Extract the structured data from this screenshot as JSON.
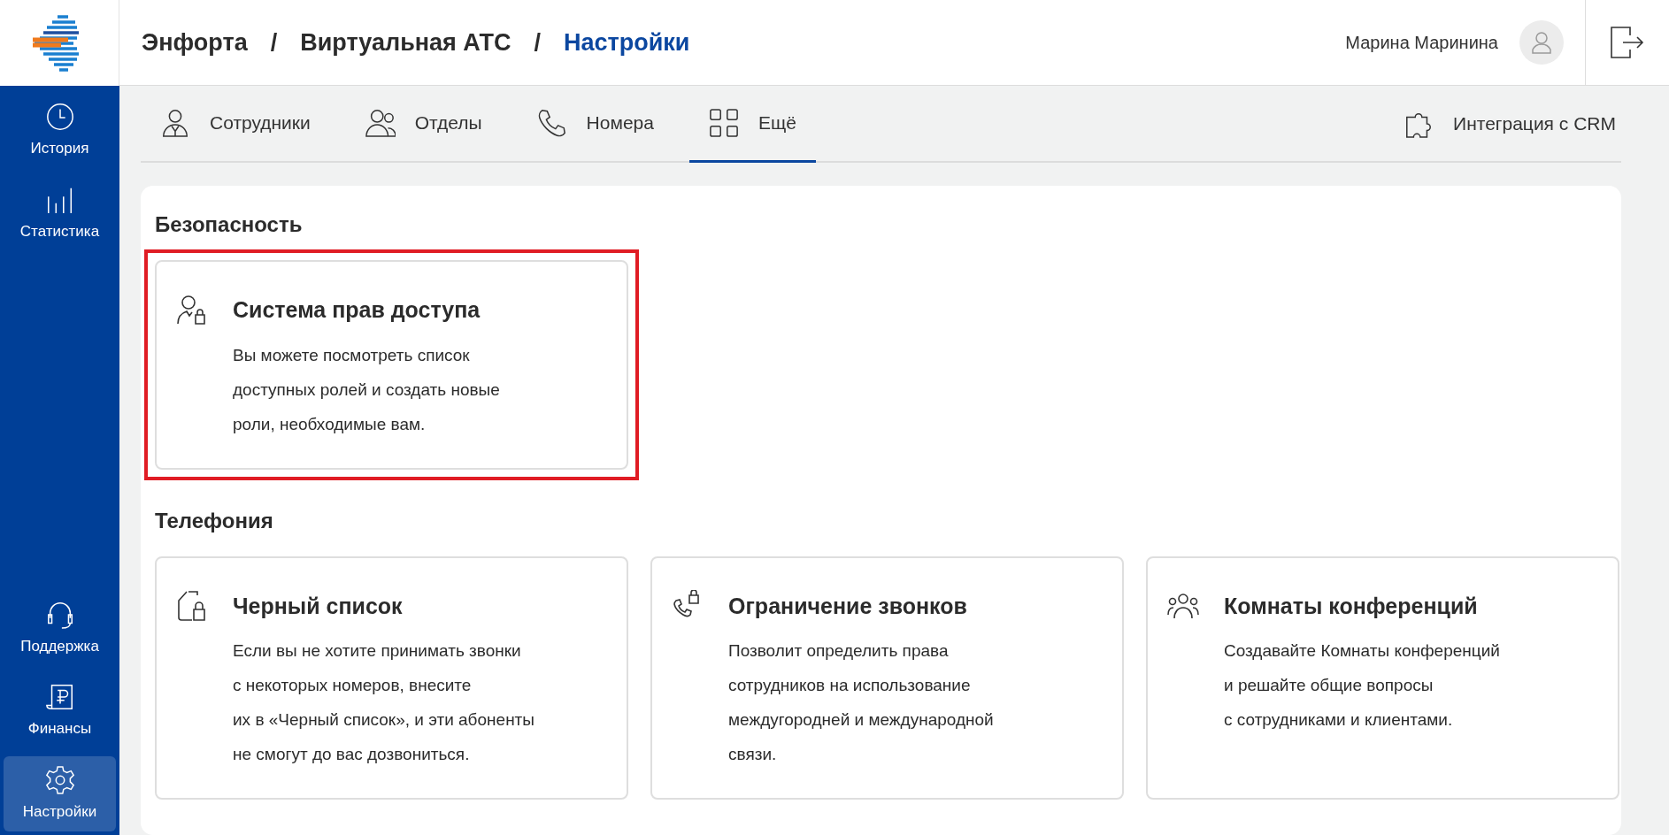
{
  "sidebar": {
    "items": [
      {
        "label": "История",
        "selected": false
      },
      {
        "label": "Статистика",
        "selected": false
      },
      {
        "label": "Поддержка",
        "selected": false
      },
      {
        "label": "Финансы",
        "selected": false
      },
      {
        "label": "Настройки",
        "selected": true
      }
    ]
  },
  "breadcrumb": [
    {
      "label": "Энфорта",
      "current": false
    },
    {
      "label": "Виртуальная АТС",
      "current": false
    },
    {
      "label": "Настройки",
      "current": true
    }
  ],
  "breadcrumb_separator": "/",
  "user": {
    "name": "Марина Маринина"
  },
  "tabs": [
    {
      "label": "Сотрудники",
      "selected": false
    },
    {
      "label": "Отделы",
      "selected": false
    },
    {
      "label": "Номера",
      "selected": false
    },
    {
      "label": "Ещё",
      "selected": true
    }
  ],
  "crm_link": {
    "label": "Интеграция с CRM"
  },
  "sections": [
    {
      "title": "Безопасность",
      "cards": [
        {
          "title": "Система прав доступа",
          "highlighted": true,
          "description": "Вы можете посмотреть список\nдоступных ролей и создать новые\nроли, необходимые вам."
        }
      ]
    },
    {
      "title": "Телефония",
      "cards": [
        {
          "title": "Черный список",
          "highlighted": false,
          "description": "Если вы не хотите принимать звонки\nс некоторых номеров, внесите\nих в «Черный список», и эти абоненты\nне смогут до вас дозвониться."
        },
        {
          "title": "Ограничение звонков",
          "highlighted": false,
          "description": "Позволит определить права\nсотрудников на использование\nмеждугородней и международной\nсвязи."
        },
        {
          "title": "Комнаты конференций",
          "highlighted": false,
          "description": "Создавайте Комнаты конференций\nи решайте общие вопросы\nс сотрудниками и клиентами."
        }
      ]
    }
  ]
}
